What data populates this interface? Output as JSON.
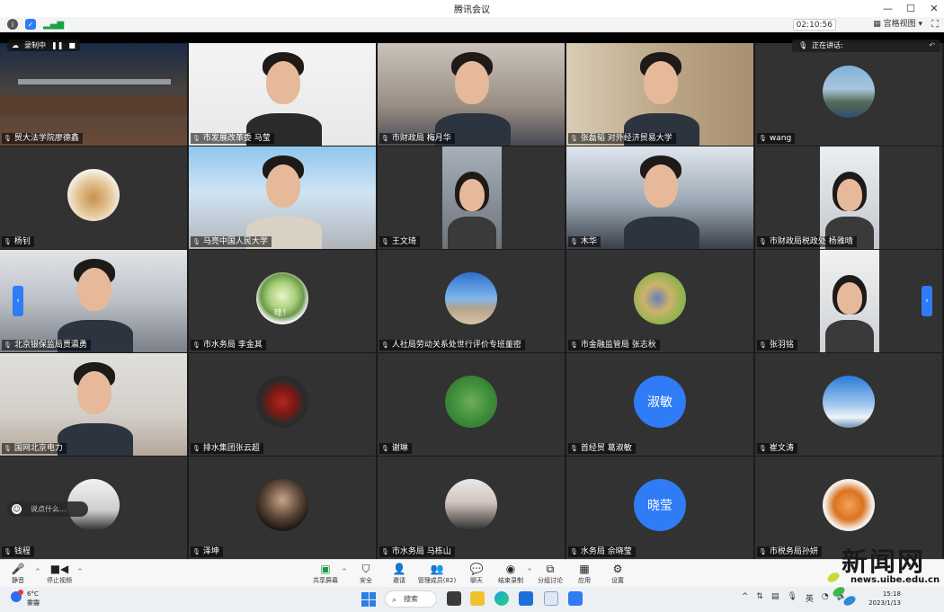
{
  "window": {
    "title": "腾讯会议",
    "controls": [
      "—",
      "☐",
      "✕"
    ]
  },
  "header": {
    "timer": "02:10:56",
    "view_label": "宫格视图",
    "view_caret": "▾"
  },
  "recording": {
    "label": "录制中"
  },
  "speaking": {
    "label": "正在讲话:"
  },
  "participants": [
    {
      "name": "贸大法学院廖德鑫",
      "kind": "video",
      "scene": "room"
    },
    {
      "name": "市发展改革委 马莹",
      "kind": "video",
      "scene": "white"
    },
    {
      "name": "市财政局 梅月华",
      "kind": "video",
      "scene": "office"
    },
    {
      "name": "张磊韬 对外经济贸易大学",
      "kind": "video",
      "scene": "shelf"
    },
    {
      "name": "wang",
      "kind": "avatar",
      "avatar": "mountain-lake"
    },
    {
      "name": "杨钊",
      "kind": "avatar",
      "avatar": "food-box"
    },
    {
      "name": "马亮中国人民大学",
      "kind": "video",
      "scene": "campus"
    },
    {
      "name": "王文琦",
      "kind": "portrait",
      "scene": "portrait1"
    },
    {
      "name": "木华",
      "kind": "video",
      "scene": "snow"
    },
    {
      "name": "市财政局税政处 杨雅晴",
      "kind": "portrait",
      "scene": "portrait2"
    },
    {
      "name": "北京银保监局贾瀛勇",
      "kind": "video",
      "scene": "office2"
    },
    {
      "name": "市水务局 李金其",
      "kind": "avatar",
      "avatar": "cucumber",
      "avatar_text": "哇！"
    },
    {
      "name": "人社局劳动关系处世行评价专班董密",
      "kind": "avatar",
      "avatar": "sky-sea"
    },
    {
      "name": "市金融监管局 张志秋",
      "kind": "avatar",
      "avatar": "flower-girl"
    },
    {
      "name": "张羽铭",
      "kind": "portrait",
      "scene": "portrait3"
    },
    {
      "name": "国网北京电力",
      "kind": "video",
      "scene": "indoor"
    },
    {
      "name": "排水集团张云超",
      "kind": "avatar",
      "avatar": "superman-logo"
    },
    {
      "name": "谢琳",
      "kind": "avatar",
      "avatar": "lotus-leaves"
    },
    {
      "name": "首经贸 葛淑敏",
      "kind": "initials",
      "avatar_text": "淑敏"
    },
    {
      "name": "崔文涛",
      "kind": "avatar",
      "avatar": "blue-sky"
    },
    {
      "name": "钱程",
      "kind": "avatar",
      "avatar": "couple-photo"
    },
    {
      "name": "泽坤",
      "kind": "avatar",
      "avatar": "godfather"
    },
    {
      "name": "市水务局 马栋山",
      "kind": "avatar",
      "avatar": "couple-photo2"
    },
    {
      "name": "水务局 佘晓莹",
      "kind": "initials",
      "avatar_text": "晓莹"
    },
    {
      "name": "市税务局孙妍",
      "kind": "avatar",
      "avatar": "tiger-cartoon"
    }
  ],
  "chat": {
    "placeholder": "说点什么..."
  },
  "toolbar": {
    "left": [
      {
        "label": "静音",
        "icon": "microphone-icon"
      },
      {
        "label": "停止视频",
        "icon": "camera-icon"
      }
    ],
    "center": [
      {
        "label": "共享屏幕",
        "icon": "share-screen-icon"
      },
      {
        "label": "安全",
        "icon": "shield-icon"
      },
      {
        "label": "邀请",
        "icon": "invite-icon"
      },
      {
        "label": "管理成员(82)",
        "icon": "members-icon"
      },
      {
        "label": "聊天",
        "icon": "chat-icon"
      },
      {
        "label": "结束录制",
        "icon": "stop-record-icon"
      },
      {
        "label": "分组讨论",
        "icon": "breakout-icon"
      },
      {
        "label": "应用",
        "icon": "apps-icon"
      },
      {
        "label": "设置",
        "icon": "gear-icon"
      }
    ]
  },
  "taskbar": {
    "weather_temp": "6°C",
    "weather_desc": "雾霾",
    "search_label": "搜索",
    "time": "15:18",
    "date": "2023/1/13",
    "ime": "英"
  },
  "watermark": {
    "big": "新闻网",
    "url": "news.uibe.edu.cn"
  },
  "colors": {
    "accent_blue": "#2f7cf6",
    "tile_bg": "#323232",
    "recording_red": "#ff3b30"
  }
}
